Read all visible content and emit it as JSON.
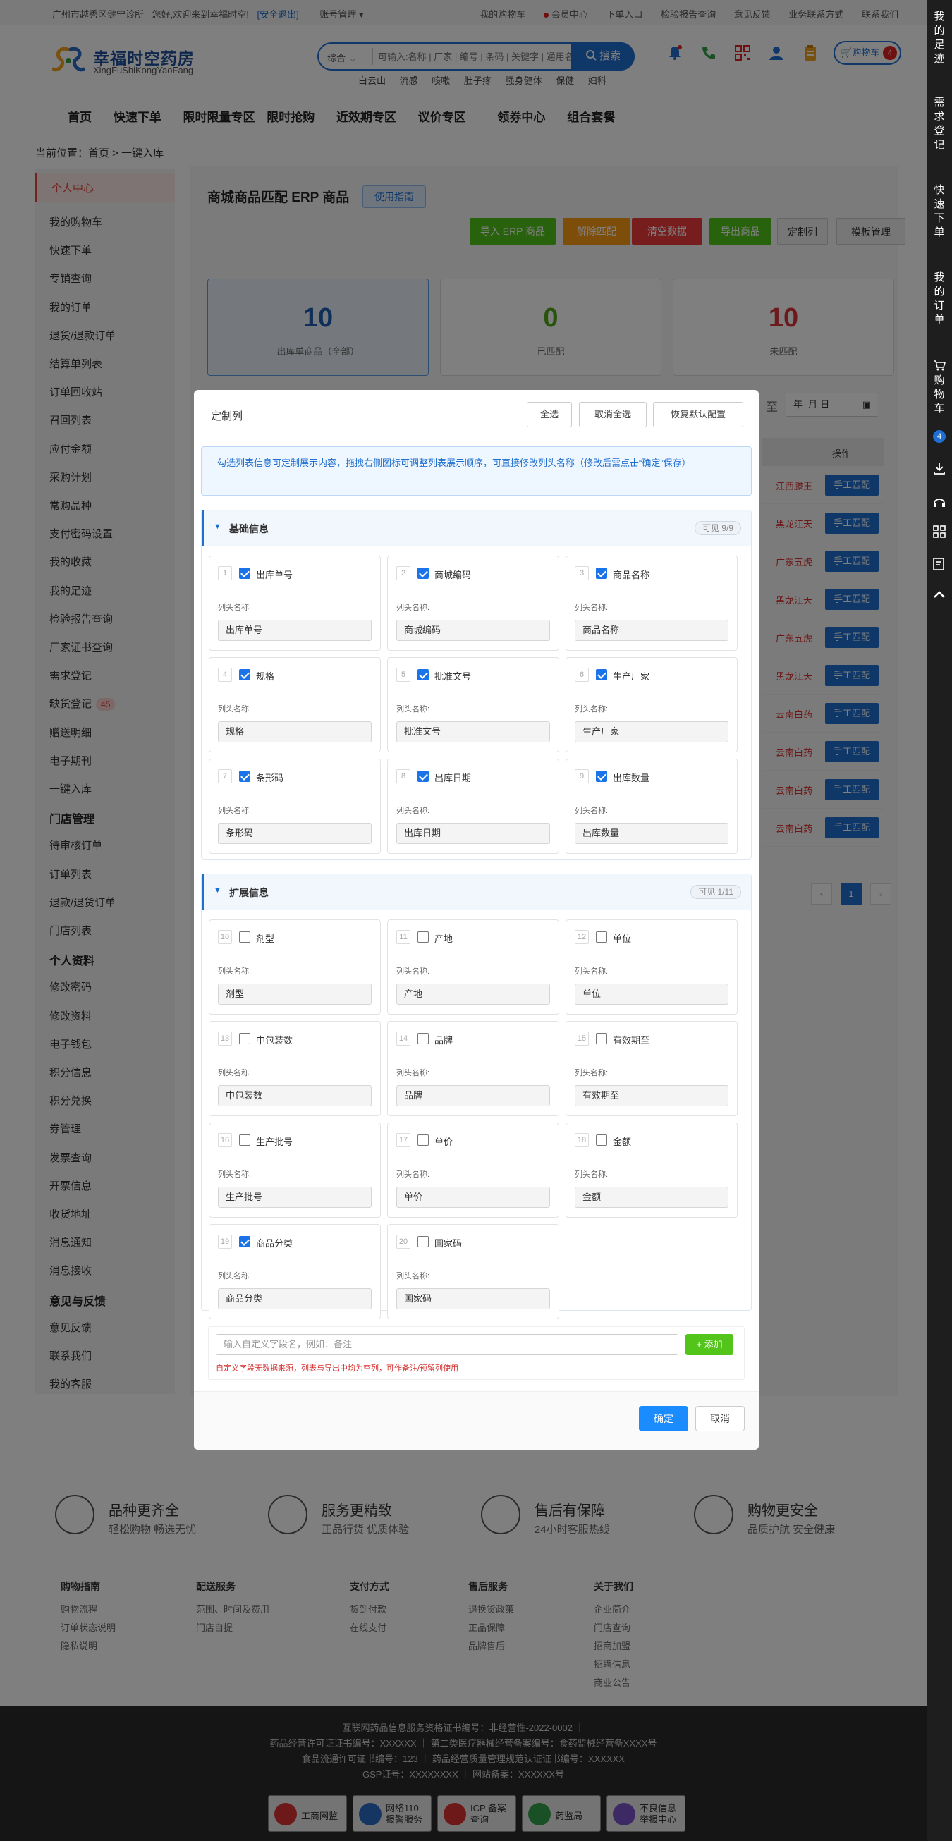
{
  "topbar": {
    "location": "广州市越秀区健宁诊所",
    "welcome": "您好,欢迎来到幸福时空!",
    "logout": "[安全退出]",
    "account": "账号管理 ▾",
    "links": [
      "我的购物车",
      "会员中心",
      "下单入口",
      "检验报告查询",
      "意见反馈",
      "业务联系方式",
      "联系我们"
    ]
  },
  "header": {
    "logo_cn": "幸福时空药房",
    "logo_en": "XingFuShiKongYaoFang",
    "search_category": "综合",
    "search_placeholder": "可输入:名称 | 厂家 | 编号 | 条码 | 关键字 | 通用名",
    "search_button": "搜索",
    "hot_words": [
      "白云山",
      "流感",
      "咳嗽",
      "肚子疼",
      "强身健体",
      "保健",
      "妇科"
    ],
    "cart_label": "购物车",
    "cart_count": "4"
  },
  "nav": [
    "首页",
    "快速下单",
    "限时限量专区",
    "限时抢购",
    "近效期专区",
    "议价专区",
    "领券中心",
    "组合套餐"
  ],
  "breadcrumb": "当前位置：首页 > 一键入库",
  "right_toolbar": {
    "footprint": "我的足迹",
    "demand": "需求登记",
    "quick_order": "快速下单",
    "my_orders": "我的订单",
    "cart": "购物车",
    "cart_count": "4"
  },
  "sidebar": {
    "active": "个人中心",
    "items": [
      "我的购物车",
      "快速下单",
      "专销查询",
      "我的订单",
      "退货/退款订单",
      "结算单列表",
      "订单回收站",
      "召回列表",
      "应付金额",
      "采购计划",
      "常购品种",
      "支付密码设置",
      "我的收藏",
      "我的足迹",
      "检验报告查询",
      "厂家证书查询",
      "需求登记"
    ],
    "missing_label": "缺货登记",
    "missing_count": "45",
    "items2": [
      "赠送明细",
      "电子期刊",
      "一键入库"
    ],
    "store_header": "门店管理",
    "store_items": [
      "待审核订单",
      "订单列表",
      "退款/退货订单",
      "门店列表"
    ],
    "profile_header": "个人资料",
    "profile_items": [
      "修改密码",
      "修改资料",
      "电子钱包",
      "积分信息",
      "积分兑换",
      "券管理",
      "发票查询",
      "开票信息",
      "收货地址",
      "消息通知",
      "消息接收"
    ],
    "feedback_header": "意见与反馈",
    "feedback_items": [
      "意见反馈",
      "联系我们",
      "我的客服"
    ]
  },
  "main": {
    "title": "商城商品匹配 ERP 商品",
    "guide": "使用指南",
    "actions": [
      "导入 ERP 商品",
      "解除匹配",
      "清空数据",
      "导出商品",
      "定制列",
      "模板管理"
    ],
    "action_colors": [
      "#52c41a",
      "#fa9b14",
      "#ef3b3b",
      "#52c41a",
      "#eeeeee",
      "#eeeeee"
    ],
    "stats": [
      {
        "num": "10",
        "label": "出库单商品（全部）",
        "color": "#1f5fb0"
      },
      {
        "num": "0",
        "label": "已匹配",
        "color": "#52a818"
      },
      {
        "num": "10",
        "label": "未匹配",
        "color": "#d8343a"
      }
    ],
    "date_to": "至",
    "date_placeholder": "年 -月-日",
    "table_header": "操作",
    "rows": [
      {
        "maker": "江西滕王",
        "btn": "手工匹配"
      },
      {
        "maker": "黑龙江天",
        "btn": "手工匹配"
      },
      {
        "maker": "广东五虎",
        "btn": "手工匹配"
      },
      {
        "maker": "黑龙江天",
        "btn": "手工匹配"
      },
      {
        "maker": "广东五虎",
        "btn": "手工匹配"
      },
      {
        "maker": "黑龙江天",
        "btn": "手工匹配"
      },
      {
        "maker": "云南白药",
        "btn": "手工匹配"
      },
      {
        "maker": "云南白药",
        "btn": "手工匹配"
      },
      {
        "maker": "云南白药",
        "btn": "手工匹配"
      },
      {
        "maker": "云南白药",
        "btn": "手工匹配"
      }
    ],
    "page_current": "1"
  },
  "modal": {
    "title": "定制列",
    "select_all": "全选",
    "deselect_all": "取消全选",
    "reset": "恢复默认配置",
    "tip": "勾选列表信息可定制展示内容，拖拽右侧图标可调整列表展示顺序，可直接修改列头名称（修改后需点击“确定”保存）",
    "column_label": "列头名称:",
    "basic": {
      "title": "基础信息",
      "count": "可见 9/9",
      "fields": [
        {
          "idx": "1",
          "name": "出库单号",
          "value": "出库单号",
          "checked": true
        },
        {
          "idx": "2",
          "name": "商城编码",
          "value": "商城编码",
          "checked": true
        },
        {
          "idx": "3",
          "name": "商品名称",
          "value": "商品名称",
          "checked": true
        },
        {
          "idx": "4",
          "name": "规格",
          "value": "规格",
          "checked": true
        },
        {
          "idx": "5",
          "name": "批准文号",
          "value": "批准文号",
          "checked": true
        },
        {
          "idx": "6",
          "name": "生产厂家",
          "value": "生产厂家",
          "checked": true
        },
        {
          "idx": "7",
          "name": "条形码",
          "value": "条形码",
          "checked": true
        },
        {
          "idx": "8",
          "name": "出库日期",
          "value": "出库日期",
          "checked": true
        },
        {
          "idx": "9",
          "name": "出库数量",
          "value": "出库数量",
          "checked": true
        }
      ]
    },
    "extended": {
      "title": "扩展信息",
      "count": "可见 1/11",
      "fields": [
        {
          "idx": "10",
          "name": "剂型",
          "value": "剂型",
          "checked": false
        },
        {
          "idx": "11",
          "name": "产地",
          "value": "产地",
          "checked": false
        },
        {
          "idx": "12",
          "name": "单位",
          "value": "单位",
          "checked": false
        },
        {
          "idx": "13",
          "name": "中包装数",
          "value": "中包装数",
          "checked": false
        },
        {
          "idx": "14",
          "name": "品牌",
          "value": "品牌",
          "checked": false
        },
        {
          "idx": "15",
          "name": "有效期至",
          "value": "有效期至",
          "checked": false
        },
        {
          "idx": "16",
          "name": "生产批号",
          "value": "生产批号",
          "checked": false
        },
        {
          "idx": "17",
          "name": "单价",
          "value": "单价",
          "checked": false
        },
        {
          "idx": "18",
          "name": "金额",
          "value": "金额",
          "checked": false
        },
        {
          "idx": "19",
          "name": "商品分类",
          "value": "商品分类",
          "checked": true
        },
        {
          "idx": "20",
          "name": "国家码",
          "value": "国家码",
          "checked": false
        }
      ]
    },
    "custom_placeholder": "输入自定义字段名，例如：备注",
    "add_button": "+ 添加",
    "custom_note": "自定义字段无数据来源，列表与导出中均为空列，可作备注/预留列使用",
    "confirm": "确定",
    "cancel": "取消"
  },
  "features": [
    {
      "title": "品种更齐全",
      "sub": "轻松购物 畅选无忧"
    },
    {
      "title": "服务更精致",
      "sub": "正品行货 优质体验"
    },
    {
      "title": "售后有保障",
      "sub": "24小时客服热线"
    },
    {
      "title": "购物更安全",
      "sub": "品质护航 安全健康"
    }
  ],
  "footer_cols": [
    {
      "head": "购物指南",
      "links": [
        "购物流程",
        "订单状态说明",
        "隐私说明"
      ]
    },
    {
      "head": "配送服务",
      "links": [
        "范围、时间及费用",
        "门店自提"
      ]
    },
    {
      "head": "支付方式",
      "links": [
        "货到付款",
        "在线支付"
      ]
    },
    {
      "head": "售后服务",
      "links": [
        "退换货政策",
        "正品保障",
        "品牌售后"
      ]
    },
    {
      "head": "关于我们",
      "links": [
        "企业简介",
        "门店查询",
        "招商加盟",
        "招聘信息",
        "商业公告"
      ]
    }
  ],
  "license_lines": [
    "互联网药品信息服务资格证书编号：非经营性-2022-0002 ｜",
    "药品经营许可证证书编号：XXXXXX ｜ 第二类医疗器械经营备案编号：食药监械经营备XXXX号",
    "食品流通许可证书编号：123 ｜ 药品经营质量管理规范认证证书编号：XXXXXX",
    "GSP证号：XXXXXXXX ｜ 网站备案：XXXXXX号"
  ],
  "badges": [
    "工商网监",
    "网络110 报警服务",
    "ICP 备案查询",
    "药监局",
    "不良信息 举报中心"
  ]
}
